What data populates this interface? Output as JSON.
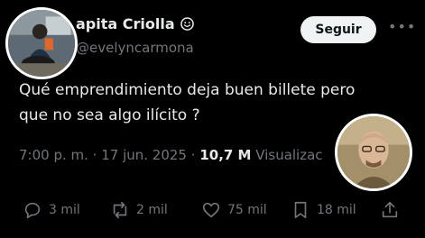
{
  "author": {
    "display_name": "apita Criolla",
    "handle": "@evelyncarmona",
    "verified_icon": "verified-badge-icon",
    "avatar_icon": "profile-photo"
  },
  "header": {
    "follow_label": "Seguir",
    "more_label": "•••",
    "more_icon": "more-icon"
  },
  "tweet": {
    "line1": "Qué emprendimiento deja buen billete pero",
    "line2": "que no sea algo ilícito ?",
    "time": "7:00 p. m.",
    "separator": "·",
    "date": "17 jun. 2025",
    "views_count": "10,7 M",
    "views_label": "Visualizac"
  },
  "actions": {
    "replies": "3 mil",
    "reposts": "2 mil",
    "likes": "75 mil",
    "bookmarks": "18 mil",
    "reply_icon": "reply-icon",
    "repost_icon": "repost-icon",
    "like_icon": "heart-icon",
    "bookmark_icon": "bookmark-icon",
    "share_icon": "share-icon"
  },
  "colors": {
    "background": "#000000",
    "text": "#e7e9ea",
    "muted": "#71767b",
    "button_bg": "#eff3f4"
  }
}
